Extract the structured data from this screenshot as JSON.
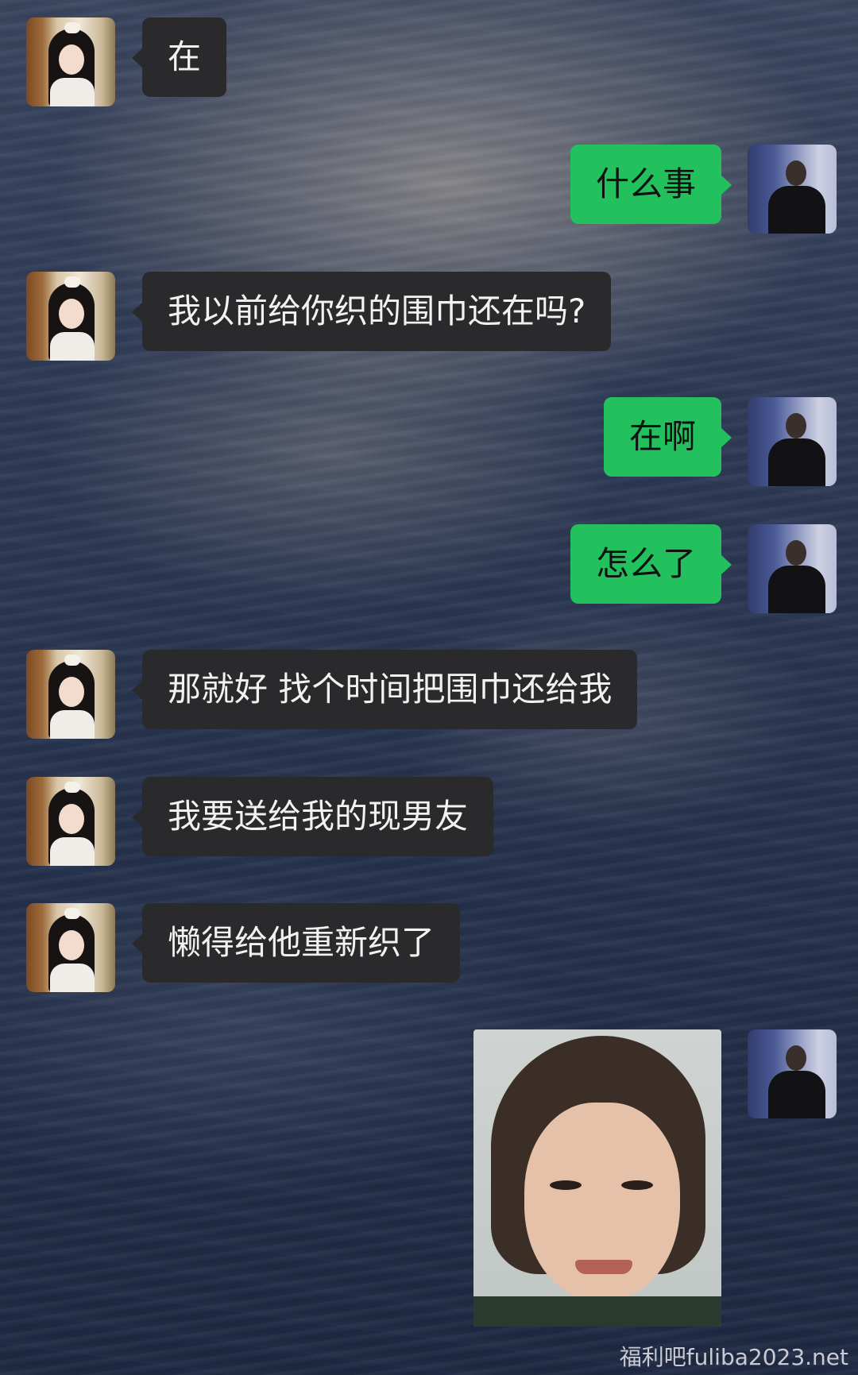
{
  "messages": [
    {
      "side": "left",
      "text": "在"
    },
    {
      "side": "right",
      "text": "什么事"
    },
    {
      "side": "left",
      "text": "我以前给你织的围巾还在吗?"
    },
    {
      "side": "right",
      "text": "在啊"
    },
    {
      "side": "right",
      "text": "怎么了"
    },
    {
      "side": "left",
      "text": "那就好 找个时间把围巾还给我"
    },
    {
      "side": "left",
      "text": "我要送给我的现男友"
    },
    {
      "side": "left",
      "text": "懒得给他重新织了"
    },
    {
      "side": "right",
      "type": "sticker",
      "icon": "grimacing-face-sticker"
    }
  ],
  "watermark": "福利吧fuliba2023.net",
  "colors": {
    "incoming_bubble": "#2a2a2c",
    "outgoing_bubble": "#22c15e",
    "background": "#2e3a56"
  }
}
